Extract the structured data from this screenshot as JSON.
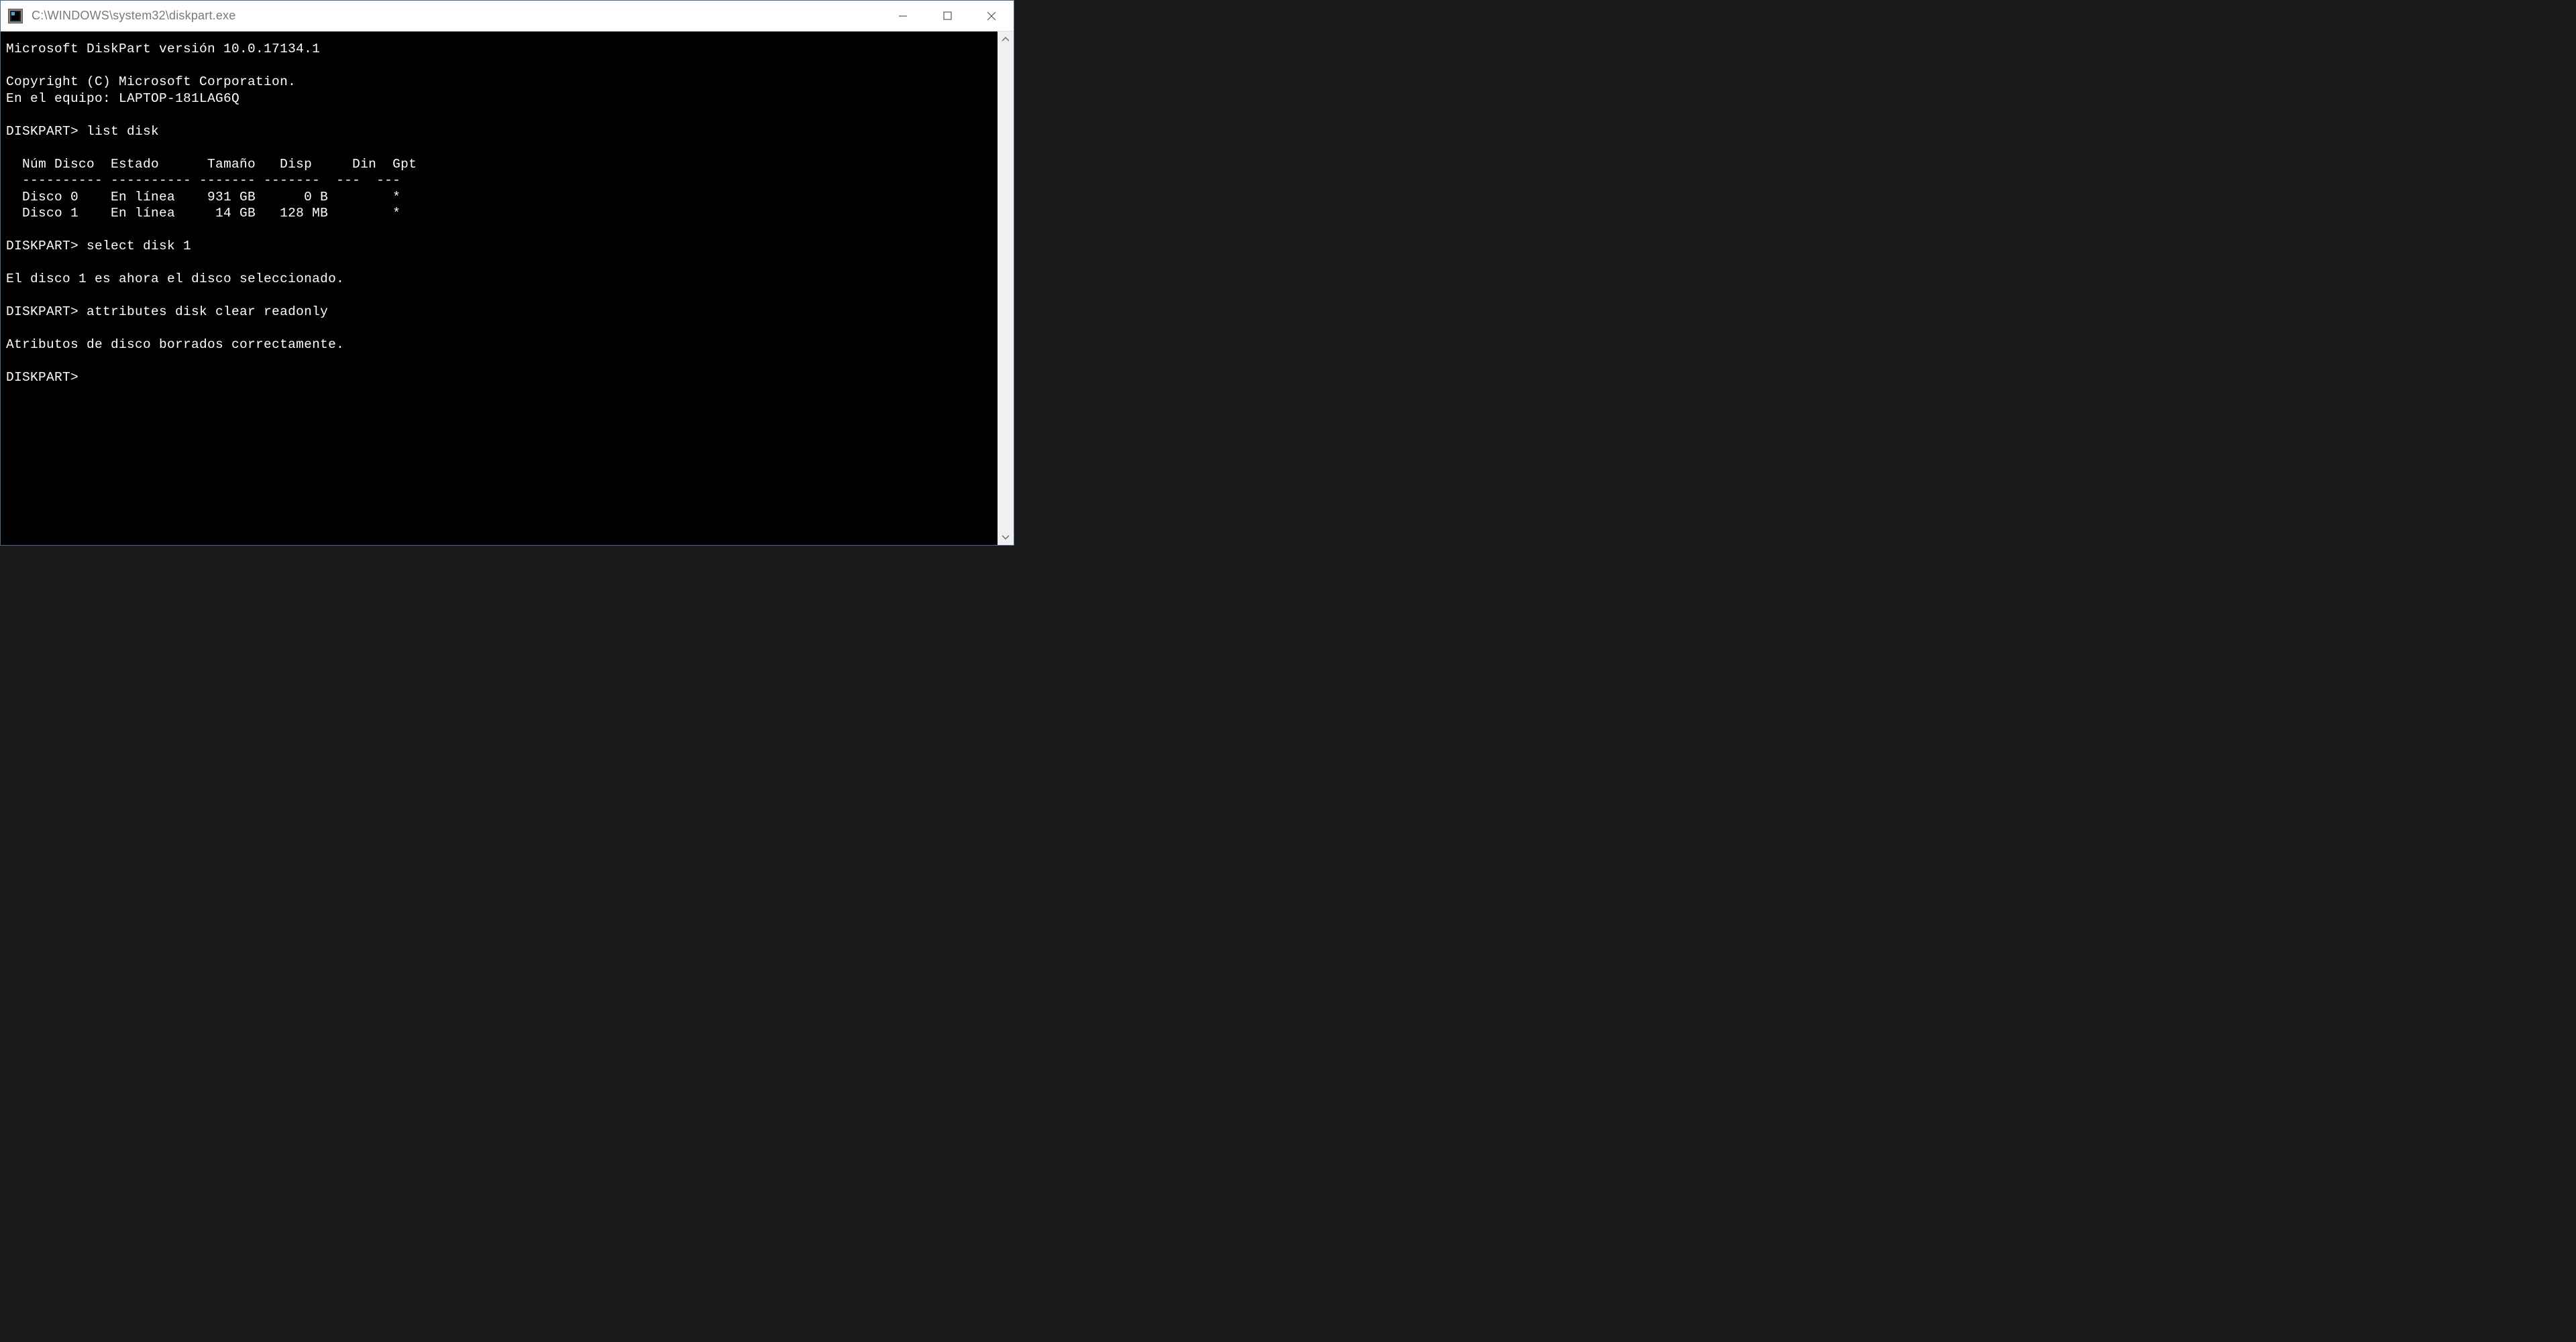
{
  "window": {
    "title": "C:\\WINDOWS\\system32\\diskpart.exe"
  },
  "terminal": {
    "lines": [
      "Microsoft DiskPart versión 10.0.17134.1",
      "",
      "Copyright (C) Microsoft Corporation.",
      "En el equipo: LAPTOP-181LAG6Q",
      "",
      "DISKPART> list disk",
      "",
      "  Núm Disco  Estado      Tamaño   Disp     Din  Gpt",
      "  ---------- ---------- ------- -------  ---  ---",
      "  Disco 0    En línea    931 GB      0 B        *",
      "  Disco 1    En línea     14 GB   128 MB        *",
      "",
      "DISKPART> select disk 1",
      "",
      "El disco 1 es ahora el disco seleccionado.",
      "",
      "DISKPART> attributes disk clear readonly",
      "",
      "Atributos de disco borrados correctamente.",
      "",
      "DISKPART>"
    ]
  },
  "diskpart": {
    "version": "10.0.17134.1",
    "copyright": "Copyright (C) Microsoft Corporation.",
    "computer": "LAPTOP-181LAG6Q",
    "prompt": "DISKPART>",
    "commands": [
      {
        "input": "list disk",
        "table": {
          "headers": [
            "Núm Disco",
            "Estado",
            "Tamaño",
            "Disp",
            "Din",
            "Gpt"
          ],
          "rows": [
            {
              "num": "Disco 0",
              "estado": "En línea",
              "tamano": "931 GB",
              "disp": "0 B",
              "din": "",
              "gpt": "*"
            },
            {
              "num": "Disco 1",
              "estado": "En línea",
              "tamano": "14 GB",
              "disp": "128 MB",
              "din": "",
              "gpt": "*"
            }
          ]
        }
      },
      {
        "input": "select disk 1",
        "output": "El disco 1 es ahora el disco seleccionado."
      },
      {
        "input": "attributes disk clear readonly",
        "output": "Atributos de disco borrados correctamente."
      }
    ]
  }
}
